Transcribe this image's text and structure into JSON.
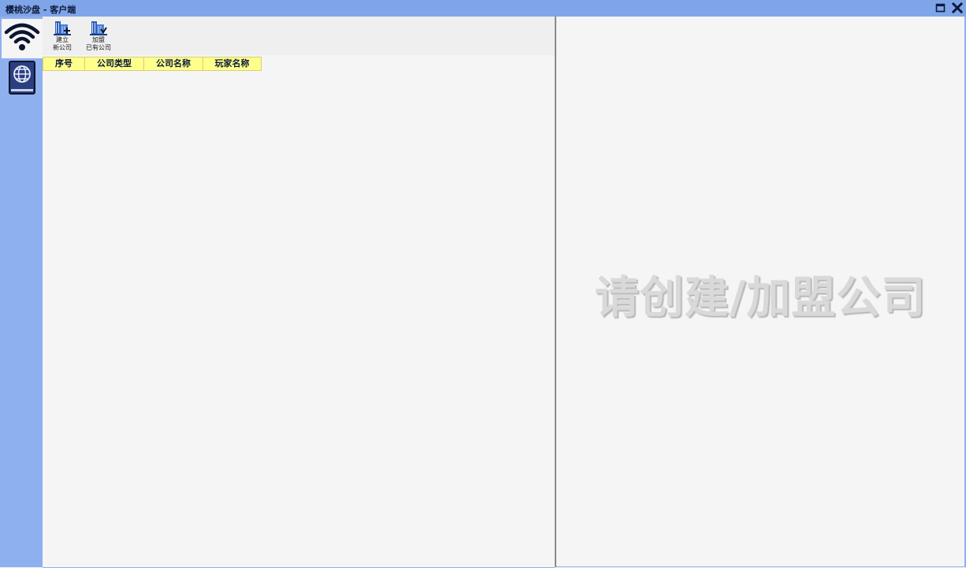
{
  "window": {
    "title": "樱桃沙盘 - 客户端",
    "controls": [
      "maximize-icon",
      "close-icon"
    ]
  },
  "nav": {
    "items": [
      {
        "icon": "wifi-icon",
        "active": true
      },
      {
        "icon": "globe-book-icon",
        "active": false
      }
    ]
  },
  "toolbar": {
    "create_line1": "建立",
    "create_line2": "新公司",
    "join_line1": "加盟",
    "join_line2": "已有公司"
  },
  "table": {
    "columns": [
      "序号",
      "公司类型",
      "公司名称",
      "玩家名称"
    ],
    "rows": []
  },
  "detail": {
    "placeholder": "请创建/加盟公司"
  },
  "colors": {
    "titlebar": "#7fa5e8",
    "sidebar": "#8fb0ee",
    "header_bg": "#ffff8c",
    "panel_bg": "#f5f5f5"
  }
}
